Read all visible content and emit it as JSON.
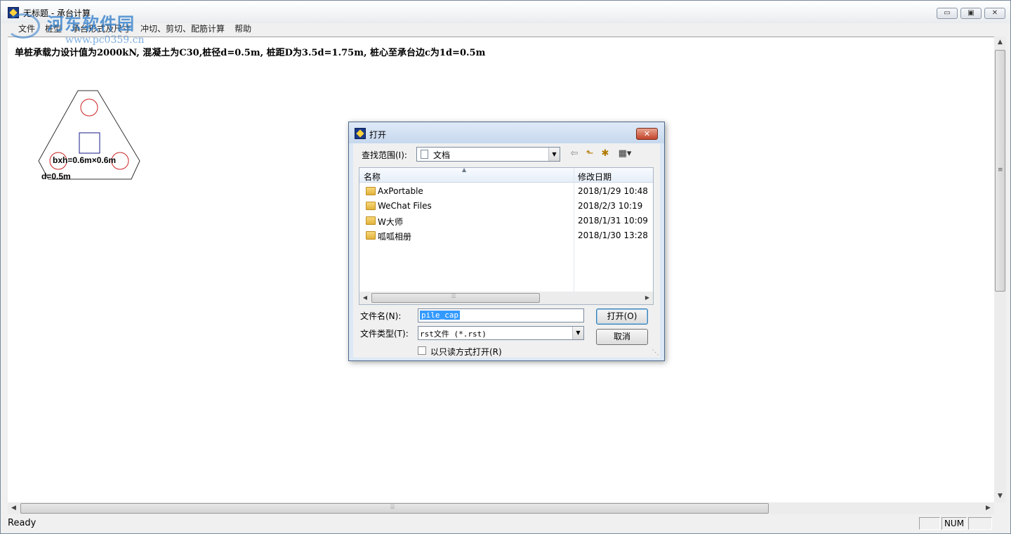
{
  "window": {
    "title": "无标题 - 承台计算",
    "controls": {
      "minimize": "▭",
      "maximize": "▣",
      "close": "✕"
    }
  },
  "menu": [
    {
      "label": "文件"
    },
    {
      "label": "桩型"
    },
    {
      "label": "承台形式及尺寸"
    },
    {
      "label": "冲切、剪切、配筋计算"
    },
    {
      "label": "帮助"
    }
  ],
  "watermark": {
    "text": "河东软件园",
    "url": "www.pc0359.cn"
  },
  "canvas": {
    "info_line": "单桩承载力设计值为2000kN, 混凝土为C30,桩径d=0.5m, 桩距D为3.5d=1.75m, 桩心至承台边c为1d=0.5m",
    "drawing": {
      "dims_label": "bxh=0.6m×0.6m",
      "diameter_label": "d=0.5m",
      "pile_count": 3
    }
  },
  "scrollbars": {
    "grip": "⦙⦙⦙"
  },
  "status": {
    "text": "Ready",
    "num_indicator": "NUM"
  },
  "dialog": {
    "title": "打开",
    "lookin_label": "查找范围(I):",
    "lookin_value": "文档",
    "toolbar": {
      "back": "⇦",
      "up": "⬑",
      "new_folder": "✱",
      "view": "▦▾"
    },
    "columns": {
      "name": "名称",
      "date": "修改日期",
      "sort_indicator": "▲"
    },
    "files": [
      {
        "name": "AxPortable",
        "date": "2018/1/29 10:48"
      },
      {
        "name": "WeChat Files",
        "date": "2018/2/3 10:19"
      },
      {
        "name": "W大师",
        "date": "2018/1/31 10:09"
      },
      {
        "name": "呱呱相册",
        "date": "2018/1/30 13:28"
      }
    ],
    "filename_label": "文件名(N):",
    "filename_value": "pile_cap",
    "filetype_label": "文件类型(T):",
    "filetype_value": "rst文件 (*.rst)",
    "open_button": "打开(O)",
    "cancel_button": "取消",
    "readonly_label": "以只读方式打开(R)",
    "close_glyph": "✕"
  },
  "colors": {
    "pile_circle": "#cc2222",
    "column_square": "#1a1a8a",
    "selection": "#3399ff"
  }
}
